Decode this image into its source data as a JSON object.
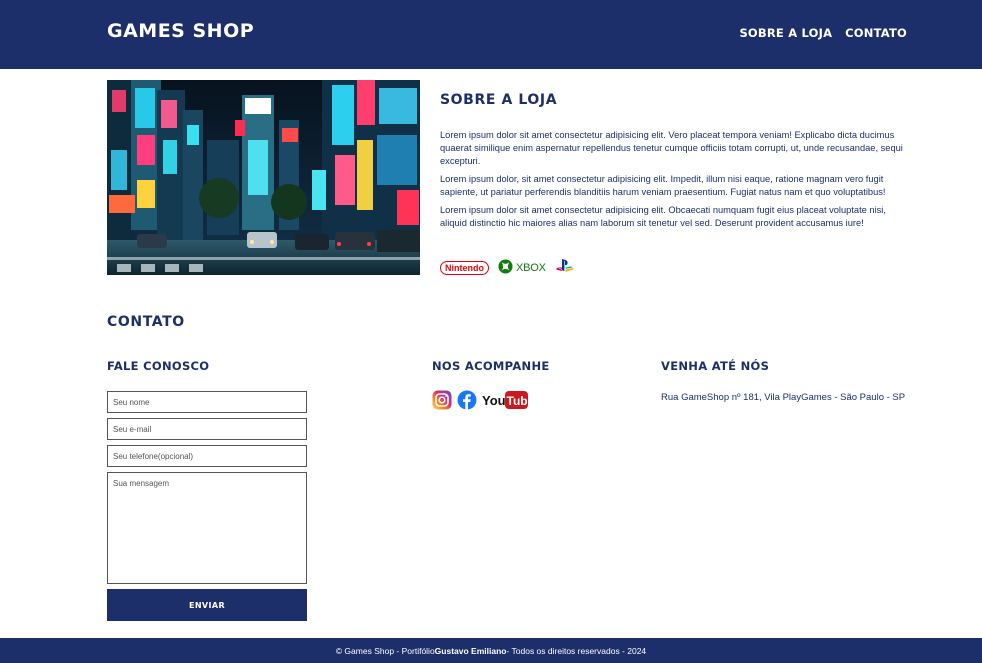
{
  "header": {
    "brand": "GAMES SHOP",
    "nav": [
      "SOBRE A LOJA",
      "CONTATO"
    ]
  },
  "about": {
    "title": "SOBRE A LOJA",
    "paragraphs": [
      "Lorem ipsum dolor sit amet consectetur adipisicing elit. Vero placeat tempora veniam! Explicabo dicta ducimus quaerat similique enim aspernatur repellendus tenetur cumque officiis totam corrupti, ut, unde recusandae, sequi excepturi.",
      "Lorem ipsum dolor, sit amet consectetur adipisicing elit. Impedit, illum nisi eaque, ratione magnam vero fugit sapiente, ut pariatur perferendis blanditiis harum veniam praesentium. Fugiat natus nam et quo voluptatibus!",
      "Lorem ipsum dolor sit amet consectetur adipisicing elit. Obcaecati numquam fugit eius placeat voluptate nisi, aliquid distinctio hic maiores alias nam laborum sit tenetur vel sed. Deserunt provident accusamus iure!"
    ],
    "brands": {
      "nintendo": "Nintendo",
      "xbox": "XBOX"
    }
  },
  "contact": {
    "title": "CONTATO",
    "form": {
      "title": "FALE CONOSCO",
      "name_placeholder": "Seu nome",
      "email_placeholder": "Seu e-mail",
      "phone_placeholder": "Seu telefone(opcional)",
      "message_placeholder": "Sua mensagem",
      "submit_label": "ENVIAR"
    },
    "social": {
      "title": "NOS ACOMPANHE",
      "youtube_you": "You",
      "youtube_tube": "Tube"
    },
    "location": {
      "title": "VENHA ATÉ NÓS",
      "address": "Rua GameShop nº 181, Vila PlayGames - São Paulo - SP"
    }
  },
  "footer": {
    "prefix": "© Games Shop - Portifólio ",
    "author": "Gustavo Emiliano",
    "suffix": " - Todos os direitos reservados - 2024"
  },
  "colors": {
    "primary": "#1d2f6b",
    "background": "#ffffff",
    "nintendo_red": "#e60012",
    "xbox_green": "#107c10",
    "playstation_blue": "#003791",
    "facebook_blue": "#1877f2",
    "youtube_red": "#cc181e"
  },
  "icons": {
    "instagram": "instagram-icon",
    "facebook": "facebook-icon",
    "youtube": "youtube-icon",
    "xbox": "xbox-icon",
    "playstation": "playstation-icon"
  }
}
